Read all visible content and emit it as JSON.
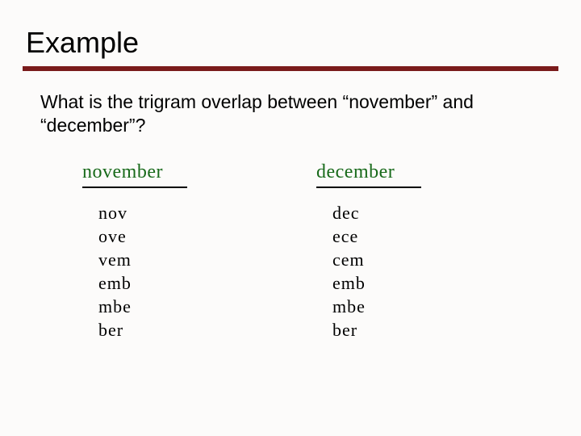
{
  "slide": {
    "title": "Example",
    "question": "What is the trigram overlap between “november” and “december”?",
    "columns": [
      {
        "word": "november",
        "trigrams": [
          "nov",
          "ove",
          "vem",
          "emb",
          "mbe",
          "ber"
        ]
      },
      {
        "word": "december",
        "trigrams": [
          "dec",
          "ece",
          "cem",
          "emb",
          "mbe",
          "ber"
        ]
      }
    ]
  }
}
